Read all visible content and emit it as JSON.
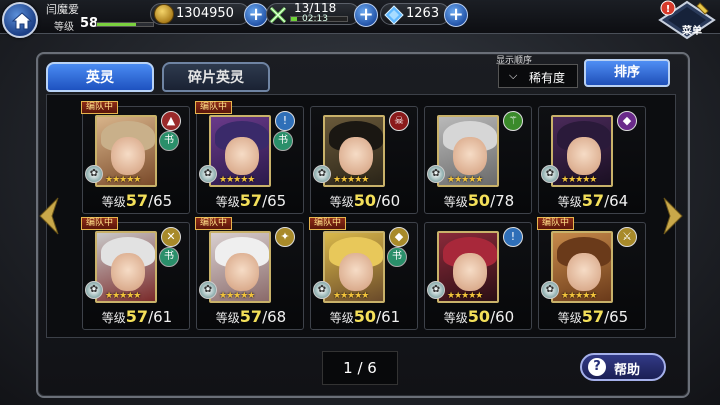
{
  "player": {
    "name": "闫魔爱",
    "level_label": "等级",
    "level": "58",
    "level_progress": 0.7
  },
  "resources": {
    "coins": "1304950",
    "stamina": "13/118",
    "stamina_timer": "02:13",
    "stamina_progress": 0.11,
    "gems": "1263"
  },
  "menu": {
    "label": "菜单",
    "alert": "!"
  },
  "tabs": [
    {
      "label": "英灵",
      "active": true
    },
    {
      "label": "碎片英灵",
      "active": false
    }
  ],
  "sort": {
    "caption": "显示顺序",
    "value": "稀有度",
    "button": "排序"
  },
  "heroes": [
    {
      "party": "编队中",
      "level_label": "等级",
      "level": "57",
      "max": "/65",
      "stars": "★★★★★",
      "element": "▲",
      "class": "书",
      "ec": "#9a2a2a",
      "cc": "#2a8f6a",
      "c1": "#d8b48a",
      "c2": "#7a4a2a",
      "hair": "#c9b08a"
    },
    {
      "party": "编队中",
      "level_label": "等级",
      "level": "57",
      "max": "/65",
      "stars": "★★★★★",
      "element": "!",
      "class": "书",
      "ec": "#2f6fb8",
      "cc": "#2a8f6a",
      "c1": "#6a3a8a",
      "c2": "#2a1a4a",
      "hair": "#3a2a6a"
    },
    {
      "party": "",
      "level_label": "等级",
      "level": "50",
      "max": "/60",
      "stars": "★★★★★",
      "element": "☠",
      "class": "",
      "ec": "#8a1a1a",
      "cc": "#333",
      "c1": "#6a5a3a",
      "c2": "#2a2418",
      "hair": "#1a1712"
    },
    {
      "party": "",
      "level_label": "等级",
      "level": "50",
      "max": "/78",
      "stars": "★★★★★",
      "element": "⚚",
      "class": "",
      "ec": "#3a8a2a",
      "cc": "#333",
      "c1": "#b9b9b9",
      "c2": "#6a6a6a",
      "hair": "#d6d6d6"
    },
    {
      "party": "",
      "level_label": "等级",
      "level": "57",
      "max": "/64",
      "stars": "★★★★★",
      "element": "◆",
      "class": "",
      "ec": "#6a2a8a",
      "cc": "#333",
      "c1": "#4a2a5a",
      "c2": "#1a0f22",
      "hair": "#2a1a3a"
    },
    {
      "party": "编队中",
      "level_label": "等级",
      "level": "57",
      "max": "/61",
      "stars": "★★★★★",
      "element": "✕",
      "class": "书",
      "ec": "#a88a2a",
      "cc": "#2a8f6a",
      "c1": "#c9c9c9",
      "c2": "#7a2a2a",
      "hair": "#e2e2e2"
    },
    {
      "party": "编队中",
      "level_label": "等级",
      "level": "57",
      "max": "/68",
      "stars": "★★★★★",
      "element": "✦",
      "class": "",
      "ec": "#a88a2a",
      "cc": "#333",
      "c1": "#d9d0d0",
      "c2": "#8a6a6a",
      "hair": "#efefef"
    },
    {
      "party": "编队中",
      "level_label": "等级",
      "level": "50",
      "max": "/61",
      "stars": "★★★★★",
      "element": "◆",
      "class": "书",
      "ec": "#a88a2a",
      "cc": "#2a8f6a",
      "c1": "#d9b84a",
      "c2": "#6a4a2a",
      "hair": "#e8c85a"
    },
    {
      "party": "",
      "level_label": "等级",
      "level": "50",
      "max": "/60",
      "stars": "★★★★★",
      "element": "!",
      "class": "",
      "ec": "#2f6fb8",
      "cc": "#333",
      "c1": "#8a2a3a",
      "c2": "#2a0f14",
      "hair": "#a8283a"
    },
    {
      "party": "编队中",
      "level_label": "等级",
      "level": "57",
      "max": "/65",
      "stars": "★★★★★",
      "element": "⚔",
      "class": "",
      "ec": "#a88a2a",
      "cc": "#333",
      "c1": "#c78a4a",
      "c2": "#6a3a1a",
      "hair": "#6a3a1a"
    }
  ],
  "pager": "1 / 6",
  "help": {
    "icon": "?",
    "label": "帮助"
  }
}
